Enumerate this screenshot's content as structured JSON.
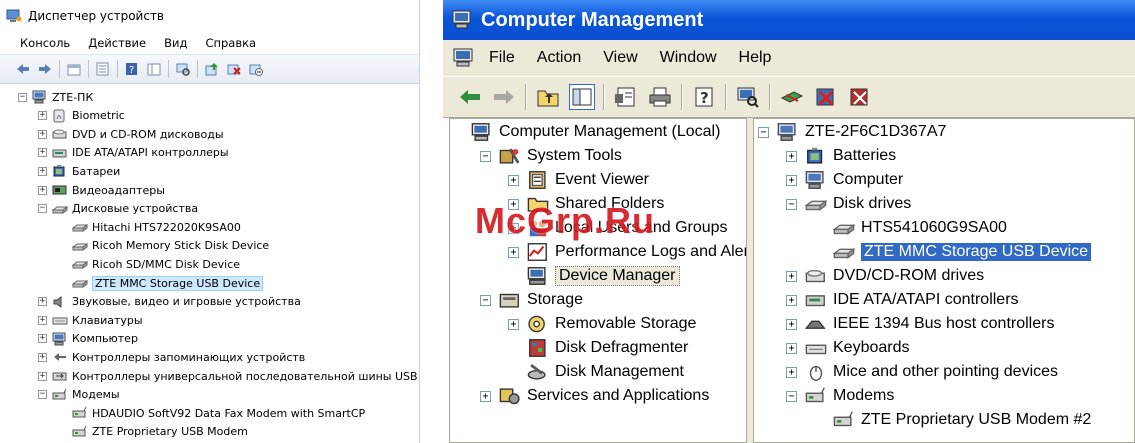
{
  "left_window": {
    "title": "Диспетчер устройств",
    "menu": [
      "Консоль",
      "Действие",
      "Вид",
      "Справка"
    ],
    "toolbar_icons": [
      "back-icon",
      "forward-icon",
      "up-icon",
      "properties-icon",
      "help-icon",
      "show-hide-icon",
      "scan-icon",
      "update-driver-icon",
      "uninstall-icon",
      "disable-icon"
    ],
    "tree": [
      {
        "label": "ZTE-ПК",
        "level": 0,
        "exp": "−",
        "icon": "computer-icon"
      },
      {
        "label": "Biometric",
        "level": 1,
        "exp": "+",
        "icon": "fingerprint-icon"
      },
      {
        "label": "DVD и CD-ROM дисководы",
        "level": 1,
        "exp": "+",
        "icon": "dvd-icon"
      },
      {
        "label": "IDE ATA/ATAPI контроллеры",
        "level": 1,
        "exp": "+",
        "icon": "ide-controller-icon"
      },
      {
        "label": "Батареи",
        "level": 1,
        "exp": "+",
        "icon": "battery-icon"
      },
      {
        "label": "Видеоадаптеры",
        "level": 1,
        "exp": "+",
        "icon": "display-adapter-icon"
      },
      {
        "label": "Дисковые устройства",
        "level": 1,
        "exp": "−",
        "icon": "disk-drive-icon"
      },
      {
        "label": "Hitachi HTS722020K9SA00",
        "level": 2,
        "exp": "",
        "icon": "hard-disk-icon"
      },
      {
        "label": "Ricoh Memory Stick Disk Device",
        "level": 2,
        "exp": "",
        "icon": "hard-disk-icon"
      },
      {
        "label": "Ricoh SD/MMC Disk Device",
        "level": 2,
        "exp": "",
        "icon": "hard-disk-icon"
      },
      {
        "label": "ZTE MMC Storage USB Device",
        "level": 2,
        "exp": "",
        "icon": "hard-disk-icon",
        "selected": true
      },
      {
        "label": "Звуковые, видео и игровые устройства",
        "level": 1,
        "exp": "+",
        "icon": "sound-icon"
      },
      {
        "label": "Клавиатуры",
        "level": 1,
        "exp": "+",
        "icon": "keyboard-icon"
      },
      {
        "label": "Компьютер",
        "level": 1,
        "exp": "+",
        "icon": "computer-icon"
      },
      {
        "label": "Контроллеры запоминающих устройств",
        "level": 1,
        "exp": "+",
        "icon": "storage-controller-icon"
      },
      {
        "label": "Контроллеры универсальной последовательной шины USB",
        "level": 1,
        "exp": "+",
        "icon": "usb-icon"
      },
      {
        "label": "Модемы",
        "level": 1,
        "exp": "−",
        "icon": "modem-icon"
      },
      {
        "label": "HDAUDIO SoftV92 Data Fax Modem with SmartCP",
        "level": 2,
        "exp": "",
        "icon": "modem-icon"
      },
      {
        "label": "ZTE Proprietary USB Modem",
        "level": 2,
        "exp": "",
        "icon": "modem-icon"
      }
    ]
  },
  "right_window": {
    "title": "Computer Management",
    "menu": [
      "File",
      "Action",
      "View",
      "Window",
      "Help"
    ],
    "toolbar_icons": [
      "back-icon",
      "forward-icon",
      "up-folder-icon",
      "show-hide-tree-icon",
      "properties-icon",
      "print-icon",
      "help-icon",
      "scan-hardware-icon",
      "update-driver-icon",
      "disable-icon",
      "uninstall-icon"
    ],
    "left_tree": [
      {
        "label": "Computer Management (Local)",
        "level": 0,
        "exp": "",
        "icon": "computer-management-icon"
      },
      {
        "label": "System Tools",
        "level": 1,
        "exp": "−",
        "icon": "system-tools-icon"
      },
      {
        "label": "Event Viewer",
        "level": 2,
        "exp": "+",
        "icon": "event-viewer-icon"
      },
      {
        "label": "Shared Folders",
        "level": 2,
        "exp": "+",
        "icon": "shared-folders-icon"
      },
      {
        "label": "Local Users and Groups",
        "level": 2,
        "exp": "+",
        "icon": "users-icon"
      },
      {
        "label": "Performance Logs and Alerts",
        "level": 2,
        "exp": "+",
        "icon": "performance-icon"
      },
      {
        "label": "Device Manager",
        "level": 2,
        "exp": "",
        "icon": "device-manager-icon",
        "highlight": true
      },
      {
        "label": "Storage",
        "level": 1,
        "exp": "−",
        "icon": "storage-icon"
      },
      {
        "label": "Removable Storage",
        "level": 2,
        "exp": "+",
        "icon": "removable-storage-icon"
      },
      {
        "label": "Disk Defragmenter",
        "level": 2,
        "exp": "",
        "icon": "defrag-icon"
      },
      {
        "label": "Disk Management",
        "level": 2,
        "exp": "",
        "icon": "disk-management-icon"
      },
      {
        "label": "Services and Applications",
        "level": 1,
        "exp": "+",
        "icon": "services-icon"
      }
    ],
    "right_tree": [
      {
        "label": "ZTE-2F6C1D367A7",
        "level": 0,
        "exp": "−",
        "icon": "computer-icon"
      },
      {
        "label": "Batteries",
        "level": 1,
        "exp": "+",
        "icon": "battery-icon"
      },
      {
        "label": "Computer",
        "level": 1,
        "exp": "+",
        "icon": "computer-icon"
      },
      {
        "label": "Disk drives",
        "level": 1,
        "exp": "−",
        "icon": "disk-drive-icon"
      },
      {
        "label": "HTS541060G9SA00",
        "level": 2,
        "exp": "",
        "icon": "hard-disk-icon"
      },
      {
        "label": "ZTE MMC Storage USB Device",
        "level": 2,
        "exp": "",
        "icon": "hard-disk-icon",
        "selected": true
      },
      {
        "label": "DVD/CD-ROM drives",
        "level": 1,
        "exp": "+",
        "icon": "dvd-icon"
      },
      {
        "label": "IDE ATA/ATAPI controllers",
        "level": 1,
        "exp": "+",
        "icon": "ide-controller-icon"
      },
      {
        "label": "IEEE 1394 Bus host controllers",
        "level": 1,
        "exp": "+",
        "icon": "ieee1394-icon"
      },
      {
        "label": "Keyboards",
        "level": 1,
        "exp": "+",
        "icon": "keyboard-icon"
      },
      {
        "label": "Mice and other pointing devices",
        "level": 1,
        "exp": "+",
        "icon": "mouse-icon"
      },
      {
        "label": "Modems",
        "level": 1,
        "exp": "−",
        "icon": "modem-icon"
      },
      {
        "label": "ZTE Proprietary USB Modem #2",
        "level": 2,
        "exp": "",
        "icon": "modem-icon"
      }
    ]
  },
  "watermark": "McGrp.Ru",
  "colors": {
    "xp_title": "#0a55d8",
    "xp_selection": "#316ac5",
    "win7_selection": "#cde8ff",
    "watermark": "#d4151c"
  }
}
